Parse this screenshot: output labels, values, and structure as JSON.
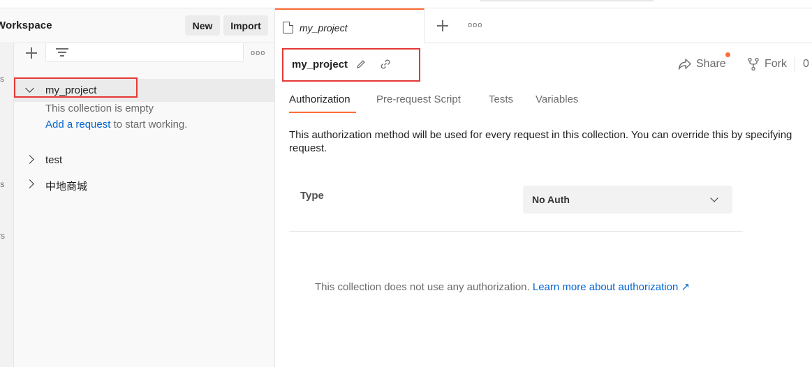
{
  "workspace": {
    "title": "Workspace",
    "new_label": "New",
    "import_label": "Import"
  },
  "rail": {
    "fragments": [
      "s",
      "ts",
      "rs"
    ]
  },
  "sidebar": {
    "more_label": "ooo",
    "collections": [
      {
        "name": "my_project",
        "expanded": true
      },
      {
        "name": "test",
        "expanded": false
      },
      {
        "name": "中地商城",
        "expanded": false
      }
    ],
    "empty_message": "This collection is empty",
    "add_request_link": "Add a request",
    "add_request_suffix": " to start working."
  },
  "tabs": {
    "open_tab_label": "my_project",
    "more_label": "ooo"
  },
  "header": {
    "collection_name": "my_project",
    "share_label": "Share",
    "fork_label": "Fork",
    "fork_count": "0"
  },
  "subtabs": [
    "Authorization",
    "Pre-request Script",
    "Tests",
    "Variables"
  ],
  "auth": {
    "description_line1": "This authorization method will be used for every request in this collection. You can override this by specifying",
    "description_line2": "request.",
    "type_label": "Type",
    "type_value": "No Auth",
    "no_auth_message": "This collection does not use any authorization. ",
    "learn_more_link": "Learn more about authorization ↗"
  },
  "colors": {
    "accent": "#ff6c37",
    "link": "#0265d2",
    "highlight_box": "#e53935"
  }
}
